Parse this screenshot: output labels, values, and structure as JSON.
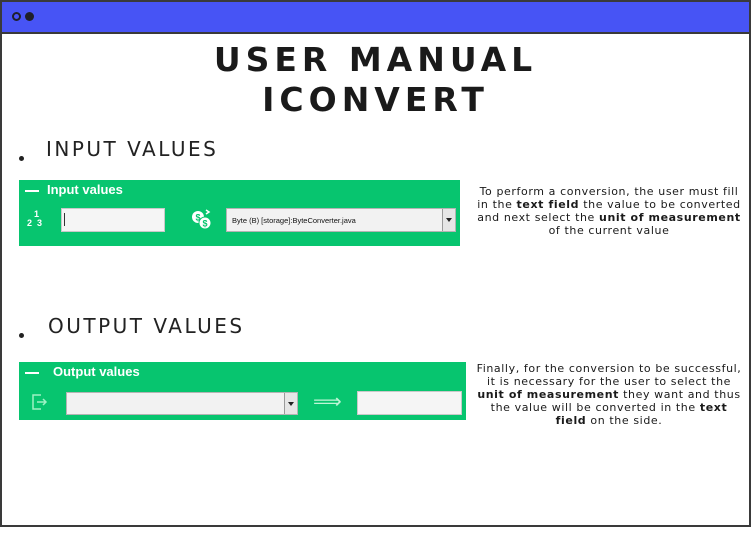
{
  "manual": {
    "title_line1": "USER MANUAL",
    "title_line2": "ICONVERT"
  },
  "input_section": {
    "heading": "INPUT VALUES",
    "panel_legend": "Input values",
    "numbers_icon_text": "1\n2 3",
    "value_field": "",
    "unit_combo_value": "Byte (B) [storage]:ByteConverter.java",
    "description": {
      "p1": "To perform a conversion, the user must fill in the ",
      "b1": "text field",
      "p2": " the value to be converted and next select the ",
      "b2": "unit of measurement",
      "p3": " of the current value"
    }
  },
  "output_section": {
    "heading": "OUTPUT VALUES",
    "panel_legend": "Output values",
    "unit_combo_value": "",
    "arrow_glyph": "⟹",
    "result_field": "",
    "description": {
      "p1": "Finally, for the conversion to be successful, it is necessary for the user to select the ",
      "b1": "unit of measurement",
      "p2": " they want and thus the value will be converted in the ",
      "b2": "text field",
      "p3": " on the side."
    }
  },
  "colors": {
    "titlebar": "#4754f5",
    "panel": "#07c56f"
  }
}
